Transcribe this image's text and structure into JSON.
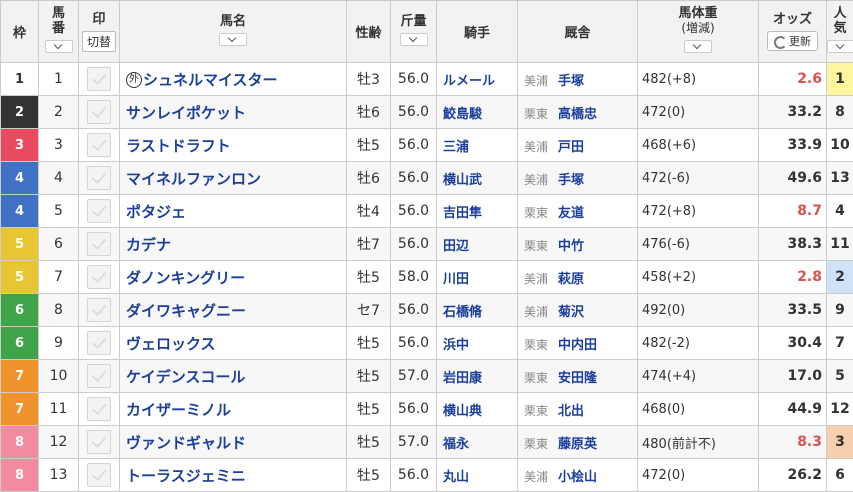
{
  "header": {
    "waku": "枠",
    "umaban_1": "馬",
    "umaban_2": "番",
    "mark": "印",
    "mark_switch": "切替",
    "horse": "馬名",
    "sex_age": "性齢",
    "kinryo": "斤量",
    "jockey": "騎手",
    "trainer": "厩舎",
    "weight_1": "馬体重",
    "weight_2": "(増減)",
    "odds": "オッズ",
    "refresh": "更新",
    "pop_1": "人",
    "pop_2": "気"
  },
  "colors": {
    "waku": {
      "1": "#ffffff",
      "2": "#333333",
      "3": "#e84a5f",
      "4": "#3f72c4",
      "5": "#e8c532",
      "6": "#3fa34a",
      "7": "#f0932b",
      "8": "#f28ba0"
    },
    "odds_red": "#d9534f",
    "pop1_bg": "#fff59d",
    "pop2_bg": "#cfe2f7",
    "pop3_bg": "#f6cfae"
  },
  "rows": [
    {
      "waku": "1",
      "umaban": "1",
      "gai": "外",
      "horse": "シュネルマイスター",
      "sex_age": "牡3",
      "kinryo": "56.0",
      "jockey": "ルメール",
      "area": "美浦",
      "trainer": "手塚",
      "weight": "482(+8)",
      "odds": "2.6",
      "pop": "1"
    },
    {
      "waku": "2",
      "umaban": "2",
      "gai": "",
      "horse": "サンレイポケット",
      "sex_age": "牡6",
      "kinryo": "56.0",
      "jockey": "鮫島駿",
      "area": "栗東",
      "trainer": "高橋忠",
      "weight": "472(0)",
      "odds": "33.2",
      "pop": "8"
    },
    {
      "waku": "3",
      "umaban": "3",
      "gai": "",
      "horse": "ラストドラフト",
      "sex_age": "牡5",
      "kinryo": "56.0",
      "jockey": "三浦",
      "area": "美浦",
      "trainer": "戸田",
      "weight": "468(+6)",
      "odds": "33.9",
      "pop": "10"
    },
    {
      "waku": "4",
      "umaban": "4",
      "gai": "",
      "horse": "マイネルファンロン",
      "sex_age": "牡6",
      "kinryo": "56.0",
      "jockey": "横山武",
      "area": "美浦",
      "trainer": "手塚",
      "weight": "472(-6)",
      "odds": "49.6",
      "pop": "13"
    },
    {
      "waku": "4",
      "umaban": "5",
      "gai": "",
      "horse": "ポタジェ",
      "sex_age": "牡4",
      "kinryo": "56.0",
      "jockey": "吉田隼",
      "area": "栗東",
      "trainer": "友道",
      "weight": "472(+8)",
      "odds": "8.7",
      "pop": "4"
    },
    {
      "waku": "5",
      "umaban": "6",
      "gai": "",
      "horse": "カデナ",
      "sex_age": "牡7",
      "kinryo": "56.0",
      "jockey": "田辺",
      "area": "栗東",
      "trainer": "中竹",
      "weight": "476(-6)",
      "odds": "38.3",
      "pop": "11"
    },
    {
      "waku": "5",
      "umaban": "7",
      "gai": "",
      "horse": "ダノンキングリー",
      "sex_age": "牡5",
      "kinryo": "58.0",
      "jockey": "川田",
      "area": "美浦",
      "trainer": "萩原",
      "weight": "458(+2)",
      "odds": "2.8",
      "pop": "2"
    },
    {
      "waku": "6",
      "umaban": "8",
      "gai": "",
      "horse": "ダイワキャグニー",
      "sex_age": "セ7",
      "kinryo": "56.0",
      "jockey": "石橋脩",
      "area": "美浦",
      "trainer": "菊沢",
      "weight": "492(0)",
      "odds": "33.5",
      "pop": "9"
    },
    {
      "waku": "6",
      "umaban": "9",
      "gai": "",
      "horse": "ヴェロックス",
      "sex_age": "牡5",
      "kinryo": "56.0",
      "jockey": "浜中",
      "area": "栗東",
      "trainer": "中内田",
      "weight": "482(-2)",
      "odds": "30.4",
      "pop": "7"
    },
    {
      "waku": "7",
      "umaban": "10",
      "gai": "",
      "horse": "ケイデンスコール",
      "sex_age": "牡5",
      "kinryo": "57.0",
      "jockey": "岩田康",
      "area": "栗東",
      "trainer": "安田隆",
      "weight": "474(+4)",
      "odds": "17.0",
      "pop": "5"
    },
    {
      "waku": "7",
      "umaban": "11",
      "gai": "",
      "horse": "カイザーミノル",
      "sex_age": "牡5",
      "kinryo": "56.0",
      "jockey": "横山典",
      "area": "栗東",
      "trainer": "北出",
      "weight": "468(0)",
      "odds": "44.9",
      "pop": "12"
    },
    {
      "waku": "8",
      "umaban": "12",
      "gai": "",
      "horse": "ヴァンドギャルド",
      "sex_age": "牡5",
      "kinryo": "57.0",
      "jockey": "福永",
      "area": "栗東",
      "trainer": "藤原英",
      "weight": "480(前計不)",
      "odds": "8.3",
      "pop": "3"
    },
    {
      "waku": "8",
      "umaban": "13",
      "gai": "",
      "horse": "トーラスジェミニ",
      "sex_age": "牡5",
      "kinryo": "56.0",
      "jockey": "丸山",
      "area": "美浦",
      "trainer": "小桧山",
      "weight": "472(0)",
      "odds": "26.2",
      "pop": "6"
    }
  ]
}
